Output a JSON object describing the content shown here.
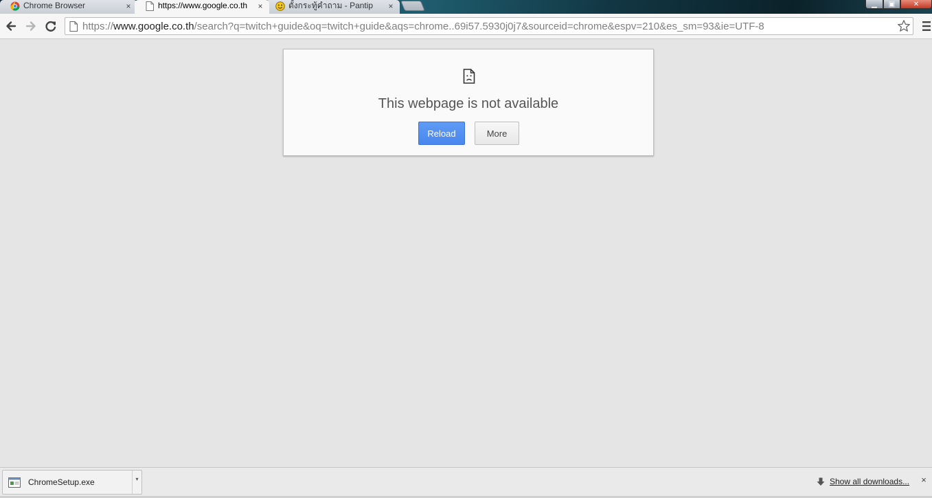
{
  "tabs": [
    {
      "title": "Chrome Browser",
      "icon": "chrome-logo-icon",
      "active": false
    },
    {
      "title": "https://www.google.co.th",
      "icon": "page-icon",
      "active": true
    },
    {
      "title": "ตั้งกระทู้คำถาม - Pantip",
      "icon": "pantip-emoji-icon",
      "active": false
    }
  ],
  "tab_close_glyph": "×",
  "window_controls": {
    "minimize": "▁",
    "maximize": "▣",
    "close": "✕"
  },
  "omnibox": {
    "url_scheme": "https://",
    "url_host": "www.google.co.th",
    "url_path": "/search?q=twitch+guide&oq=twitch+guide&aqs=chrome..69i57.5930j0j7&sourceid=chrome&espv=210&es_sm=93&ie=UTF-8"
  },
  "error": {
    "title": "This webpage is not available",
    "reload_label": "Reload",
    "more_label": "More"
  },
  "downloads": {
    "file_name": "ChromeSetup.exe",
    "menu_glyph": "▾",
    "show_all_label": "Show all downloads...",
    "close_glyph": "×"
  },
  "colors": {
    "accent_blue": "#4a87ee",
    "page_bg": "#e5e5e5",
    "toolbar_bg": "#f6f6f6"
  }
}
